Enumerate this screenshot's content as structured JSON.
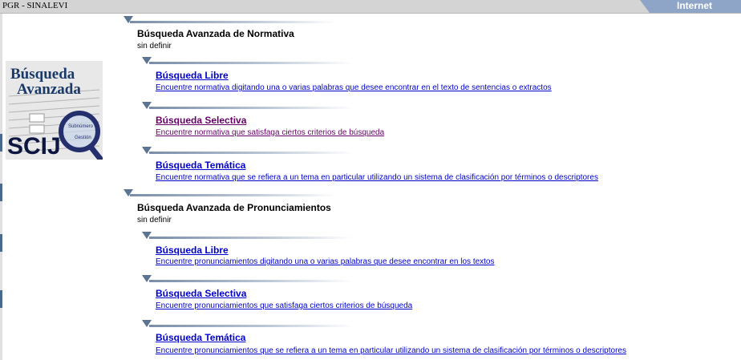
{
  "window": {
    "title": "PGR - SINALEVI",
    "zone": "Internet"
  },
  "logo": {
    "line1": "Búsqueda",
    "line2": "Avanzada",
    "brand": "SCIJ",
    "subtext1": "Subnúmero",
    "subtext2": "Gestión"
  },
  "normativa": {
    "title": "Búsqueda Avanzada de Normativa",
    "subtitle": "sin definir",
    "items": [
      {
        "label": "Búsqueda Libre",
        "desc": "Encuentre normativa digitando una o varias palabras que desee encontrar en el texto de sentencias o extractos"
      },
      {
        "label": "Búsqueda Selectiva",
        "desc": "Encuentre normativa que satisfaga ciertos criterios de búsqueda"
      },
      {
        "label": "Búsqueda Temática",
        "desc": "Encuentre normativa que se refiera a un tema en particular utilizando un sistema de clasificación por términos o descriptores"
      }
    ]
  },
  "pronunciamientos": {
    "title": "Búsqueda Avanzada de Pronunciamientos",
    "subtitle": "sin definir",
    "items": [
      {
        "label": "Búsqueda Libre",
        "desc": "Encuentre pronunciamientos digitando una o varias palabras que desee encontrar en los textos"
      },
      {
        "label": "Búsqueda Selectiva",
        "desc": "Encuentre pronunciamientos que satisfaga ciertos criterios de búsqueda"
      },
      {
        "label": "Búsqueda Temática",
        "desc": "Encuentre pronunciamientos que se refiera a un tema en particular utilizando un sistema de clasificación por términos o descriptores"
      }
    ]
  },
  "colors": {
    "link": "#0000cc",
    "visited": "#660066",
    "accent": "#5c7392"
  }
}
